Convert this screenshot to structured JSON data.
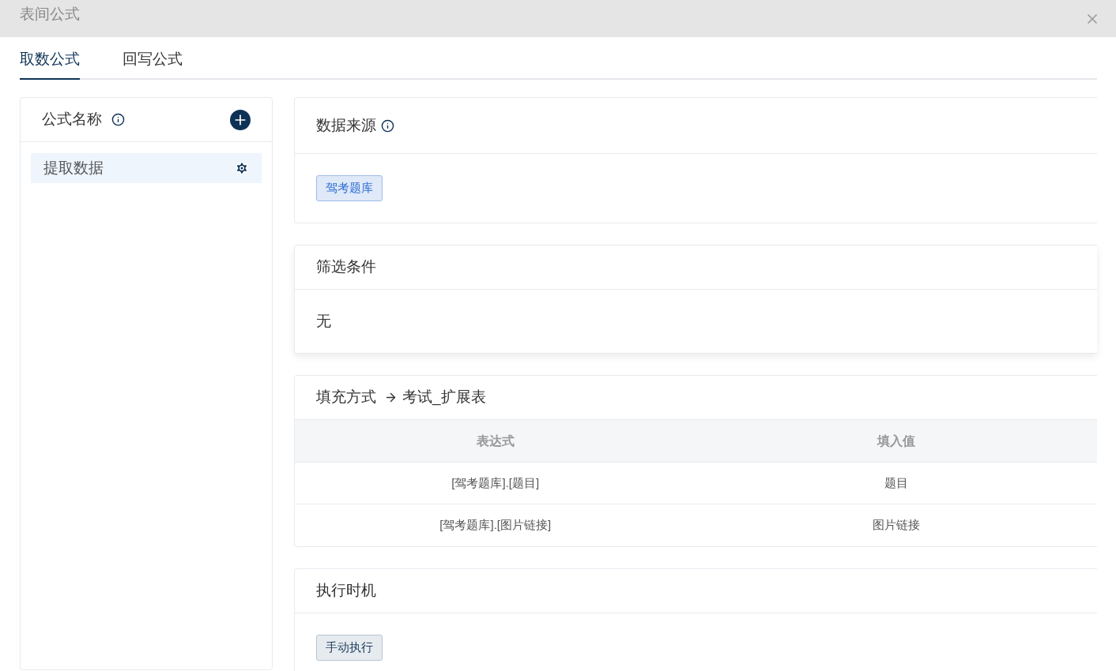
{
  "window": {
    "title": "表间公式"
  },
  "tabs": [
    {
      "label": "取数公式",
      "selected": true
    },
    {
      "label": "回写公式",
      "selected": false
    }
  ],
  "formula_list": {
    "title": "公式名称",
    "items": [
      {
        "label": "提取数据",
        "selected": true
      }
    ]
  },
  "sections": [
    {
      "kind": "source",
      "title": "数据来源",
      "info": true,
      "tag": "驾考题库"
    },
    {
      "kind": "filter",
      "title": "筛选条件",
      "text": "无"
    },
    {
      "kind": "mapping",
      "title": "填充方式",
      "target": "考试_扩展表",
      "columns": [
        "表达式",
        "填入值"
      ],
      "rows": [
        [
          "[驾考题库].[题目]",
          "题目"
        ],
        [
          "[驾考题库].[图片链接]",
          "图片链接"
        ]
      ]
    },
    {
      "kind": "trigger",
      "title": "执行时机",
      "tag": "手动执行"
    }
  ]
}
